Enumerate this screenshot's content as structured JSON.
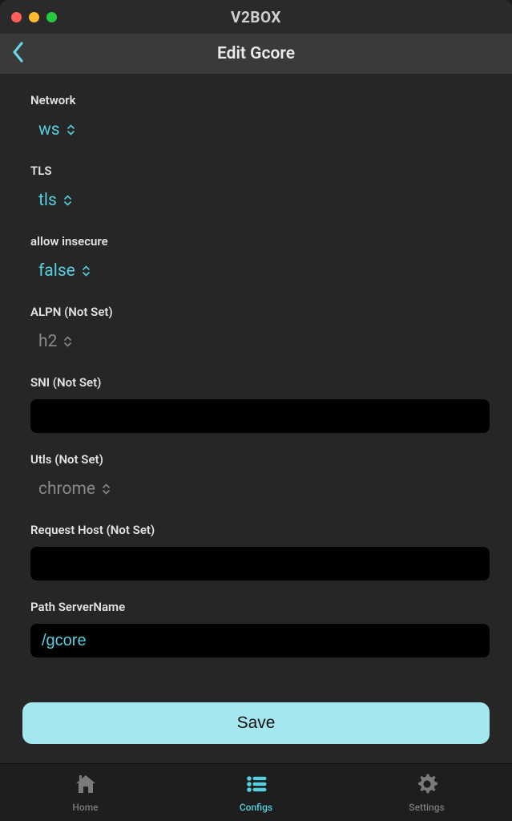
{
  "app": {
    "title": "V2BOX"
  },
  "page": {
    "title": "Edit Gcore"
  },
  "fields": {
    "network": {
      "label": "Network",
      "value": "ws",
      "kind": "select",
      "style": "cyan"
    },
    "tls": {
      "label": "TLS",
      "value": "tls",
      "kind": "select",
      "style": "cyan"
    },
    "allow_insecure": {
      "label": "allow insecure",
      "value": "false",
      "kind": "select",
      "style": "cyan"
    },
    "alpn": {
      "label": "ALPN (Not Set)",
      "value": "h2",
      "kind": "select",
      "style": "grey"
    },
    "sni": {
      "label": "SNI (Not Set)",
      "value": "",
      "kind": "text"
    },
    "utls": {
      "label": "Utls (Not Set)",
      "value": "chrome",
      "kind": "select",
      "style": "grey"
    },
    "request_host": {
      "label": "Request Host (Not Set)",
      "value": "",
      "kind": "text"
    },
    "path_servername": {
      "label": "Path ServerName",
      "value": "/gcore",
      "kind": "text"
    }
  },
  "actions": {
    "save_label": "Save"
  },
  "tabs": {
    "home": {
      "label": "Home",
      "active": false
    },
    "configs": {
      "label": "Configs",
      "active": true
    },
    "settings": {
      "label": "Settings",
      "active": false
    }
  },
  "colors": {
    "accent": "#55d0e0",
    "save_bg": "#a5e7ef"
  }
}
